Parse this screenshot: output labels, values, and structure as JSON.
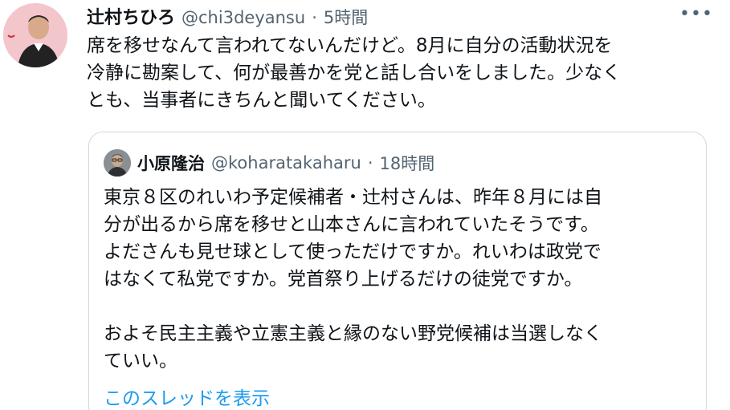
{
  "tweet": {
    "author_name": "辻村ちひろ",
    "handle": "@chi3deyansu",
    "separator": "·",
    "time": "5時間",
    "more_icon": "more-horizontal-icon",
    "text": "席を移せなんて言われてないんだけど。8月に自分の活動状況を\n冷静に勘案して、何が最善かを党と話し合いをしました。少なく\nとも、当事者にきちんと聞いてください。"
  },
  "quote": {
    "author_name": "小原隆治",
    "handle": "@koharatakaharu",
    "separator": "·",
    "time": "18時間",
    "text": "東京８区のれいわ予定候補者・辻村さんは、昨年８月には自\n分が出るから席を移せと山本さんに言われていたそうです。\nよださんも見せ球として使っただけですか。れいわは政党で\nはなくて私党ですか。党首祭り上げるだけの徒党ですか。\n\nおよそ民主主義や立憲主義と縁のない野党候補は当選しなく\nていい。",
    "show_thread_label": "このスレッドを表示"
  },
  "colors": {
    "text_primary": "#0f1419",
    "text_secondary": "#536471",
    "link": "#1d9bf0",
    "border": "#cfd9de",
    "avatar_bg": "#f3c6cc"
  }
}
